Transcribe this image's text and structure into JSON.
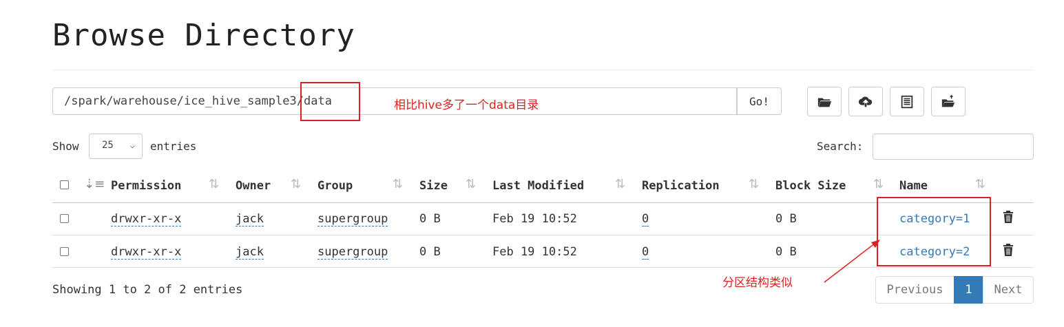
{
  "page": {
    "title": "Browse Directory"
  },
  "pathbar": {
    "path": "/spark/warehouse/ice_hive_sample3/data",
    "go_label": "Go!",
    "annotation": "相比hive多了一个data目录"
  },
  "toolbar": {
    "icons": [
      "folder-open-icon",
      "upload-cloud-icon",
      "list-icon",
      "move-folder-icon"
    ]
  },
  "table_controls": {
    "show_label": "Show",
    "entries_value": "25",
    "entries_label": "entries",
    "search_label": "Search:"
  },
  "table": {
    "headers": [
      "Permission",
      "Owner",
      "Group",
      "Size",
      "Last Modified",
      "Replication",
      "Block Size",
      "Name"
    ],
    "rows": [
      {
        "permission": "drwxr-xr-x",
        "owner": "jack",
        "group": "supergroup",
        "size": "0 B",
        "modified": "Feb 19 10:52",
        "replication": "0",
        "block_size": "0 B",
        "name": "category=1"
      },
      {
        "permission": "drwxr-xr-x",
        "owner": "jack",
        "group": "supergroup",
        "size": "0 B",
        "modified": "Feb 19 10:52",
        "replication": "0",
        "block_size": "0 B",
        "name": "category=2"
      }
    ],
    "name_annotation": "分区结构类似"
  },
  "footer": {
    "info": "Showing 1 to 2 of 2 entries",
    "previous": "Previous",
    "current_page": "1",
    "next": "Next"
  },
  "colors": {
    "link": "#337ab7",
    "annotation": "#e02020",
    "active_page": "#337ab7"
  }
}
